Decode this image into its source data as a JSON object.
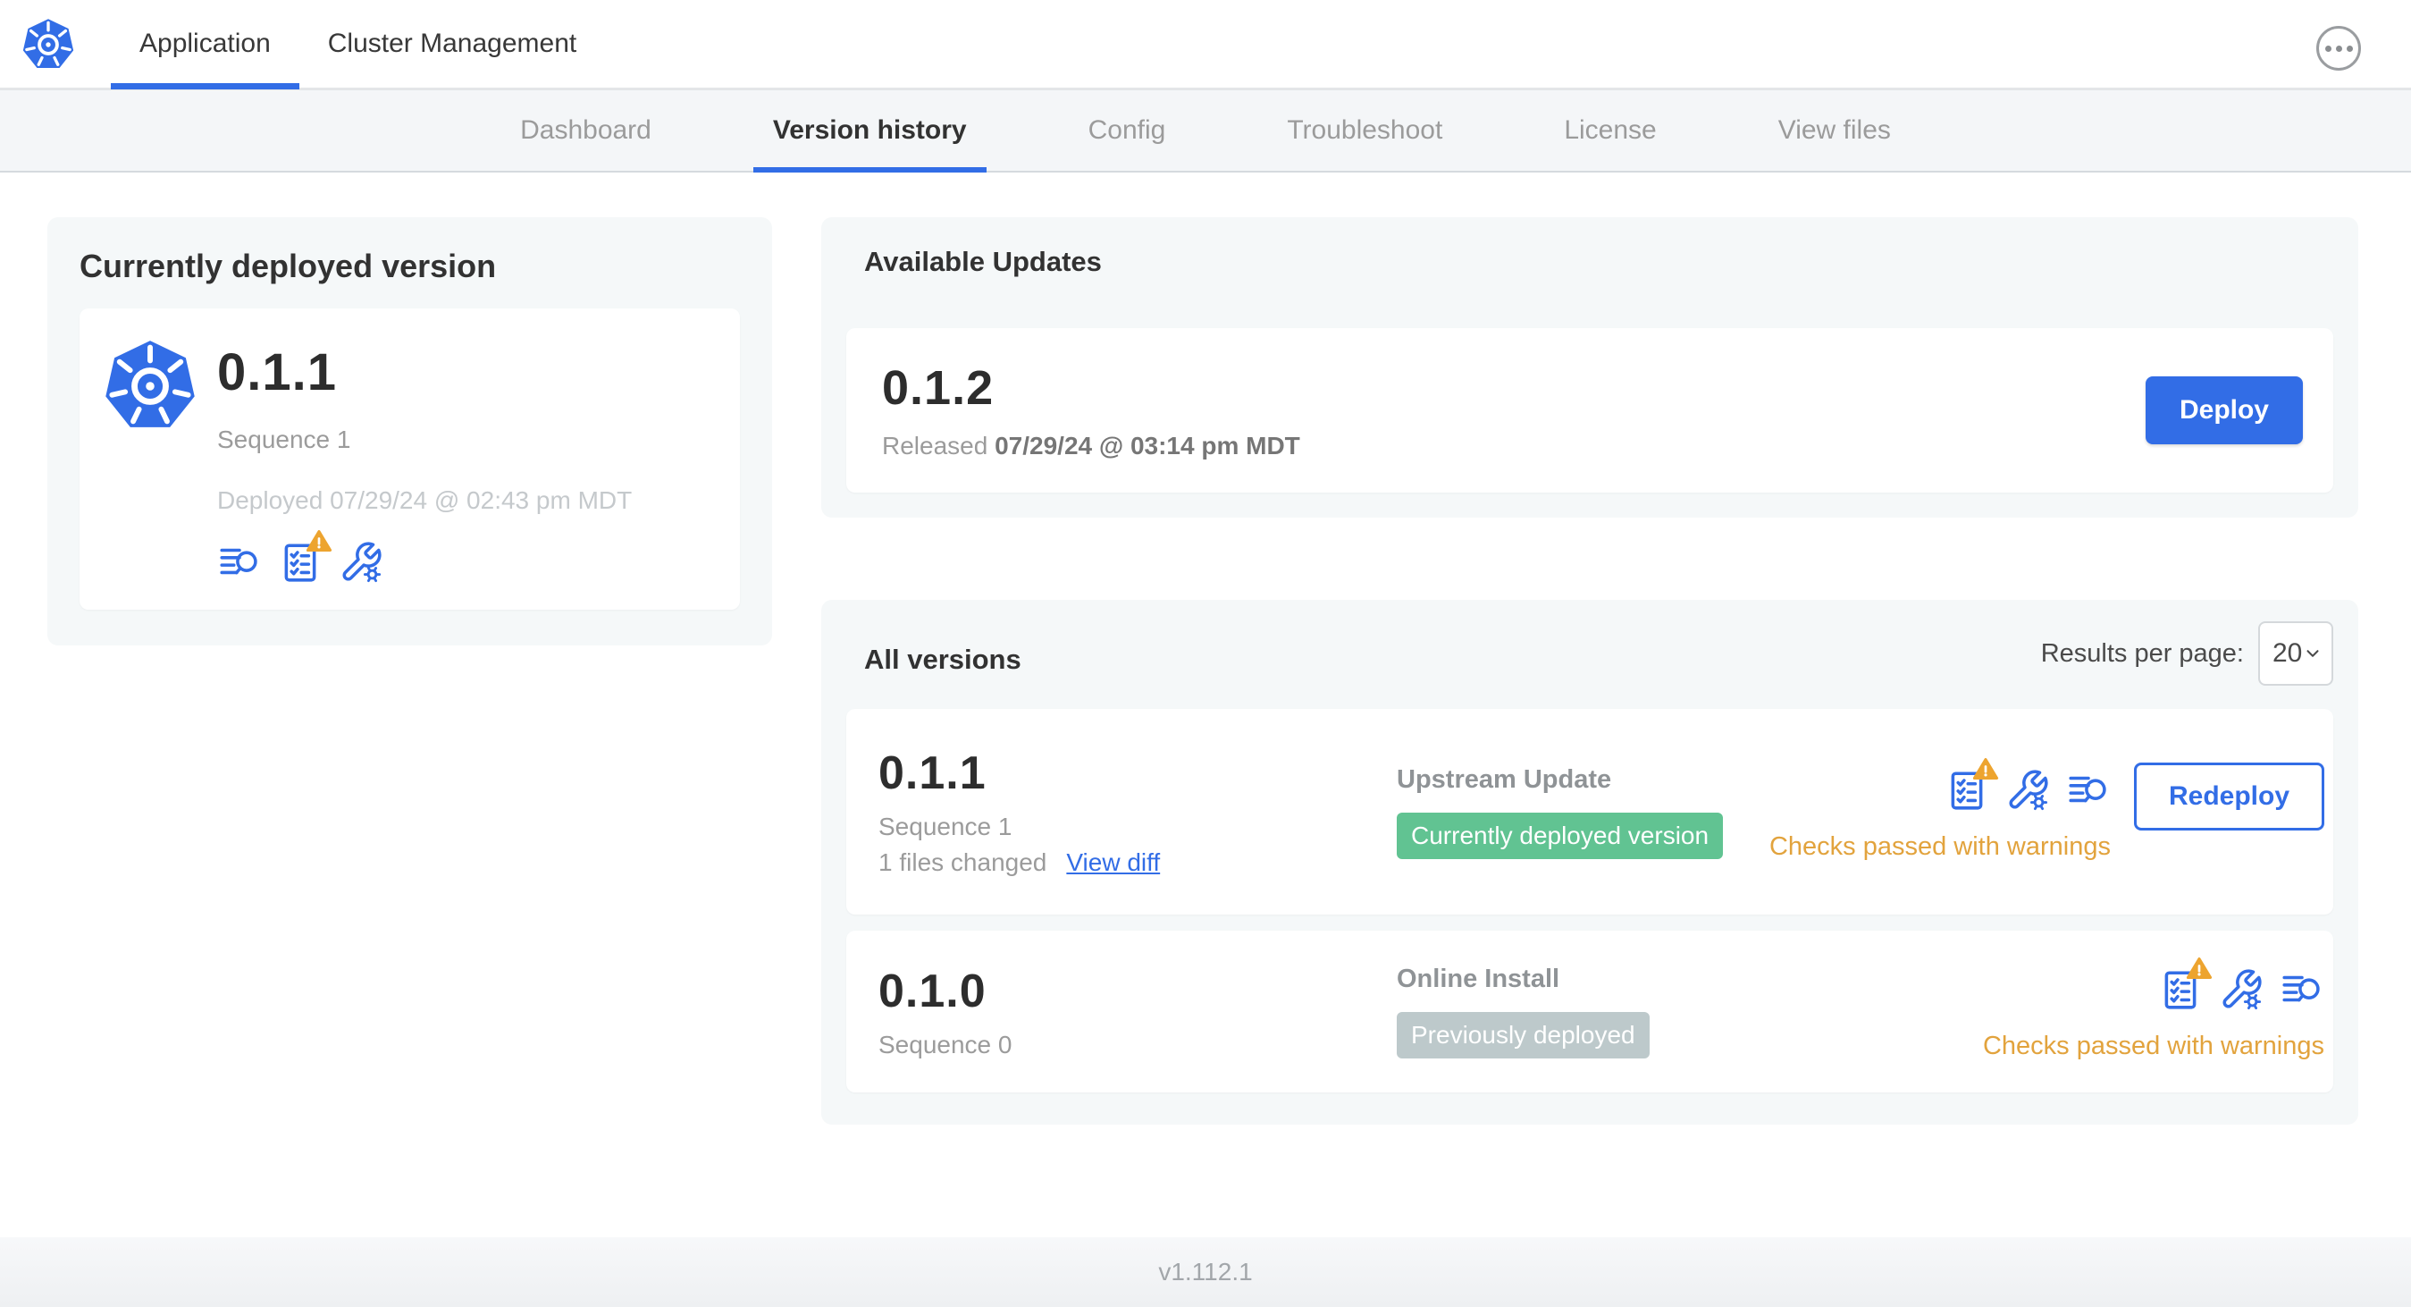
{
  "header": {
    "tabs": [
      {
        "label": "Application",
        "active": true
      },
      {
        "label": "Cluster Management",
        "active": false
      }
    ]
  },
  "subnav": {
    "tabs": [
      {
        "label": "Dashboard",
        "active": false
      },
      {
        "label": "Version history",
        "active": true
      },
      {
        "label": "Config",
        "active": false
      },
      {
        "label": "Troubleshoot",
        "active": false
      },
      {
        "label": "License",
        "active": false
      },
      {
        "label": "View files",
        "active": false
      }
    ]
  },
  "deployed_card": {
    "title": "Currently deployed version",
    "version": "0.1.1",
    "sequence": "Sequence 1",
    "deployed_at": "Deployed 07/29/24 @ 02:43 pm MDT"
  },
  "available_updates": {
    "title": "Available Updates",
    "version": "0.1.2",
    "released_prefix": "Released",
    "released_date": "07/29/24 @ 03:14 pm MDT",
    "deploy_label": "Deploy"
  },
  "all_versions": {
    "title": "All versions",
    "results_per_page_label": "Results per page:",
    "results_per_page_value": "20",
    "rows": [
      {
        "version": "0.1.1",
        "sequence": "Sequence 1",
        "files_changed": "1 files changed",
        "view_diff_label": "View diff",
        "source": "Upstream Update",
        "badge": "Currently deployed version",
        "badge_type": "green",
        "status": "Checks passed with warnings",
        "action_label": "Redeploy"
      },
      {
        "version": "0.1.0",
        "sequence": "Sequence 0",
        "source": "Online Install",
        "badge": "Previously deployed",
        "badge_type": "gray",
        "status": "Checks passed with warnings"
      }
    ]
  },
  "footer": {
    "version": "v1.112.1"
  },
  "icons": {
    "header": [
      "kubernetes-logo-icon",
      "ellipsis-menu-icon"
    ],
    "version_actions": [
      "preflight-checklist-icon",
      "wrench-gear-icon",
      "deploy-logs-icon"
    ],
    "overlay": "warning-triangle-icon",
    "select": "chevron-down-icon"
  },
  "colors": {
    "accent_blue": "#326DE6",
    "warning_amber": "#E2A33D",
    "warning_triangle": "#EDA42F",
    "badge_green": "#61C392",
    "badge_gray": "#BDC9CB",
    "panel_bg": "#F5F8F9"
  }
}
